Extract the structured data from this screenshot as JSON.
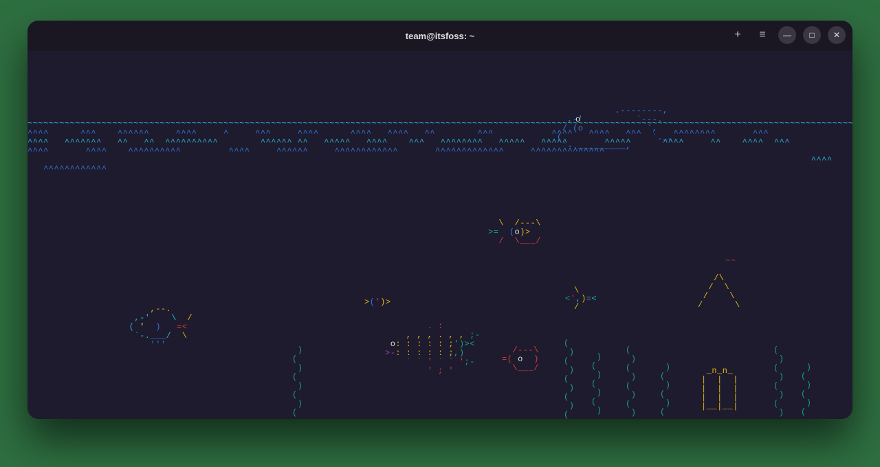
{
  "window": {
    "title": "team@itsfoss: ~"
  },
  "controls": {
    "new_tab": "+",
    "menu": "≡",
    "minimize": "—",
    "maximize": "□",
    "close": "✕"
  },
  "aquarium": {
    "water_surface": "~~~~~~~~~~~~~~~~~~~~~~~~~~~~~~~~~~~~~~~~~~~~~~~~~~~~~~~~~~~~~~~~~~~~~~~~~~~~~~~~~~~~~~~~~~~~~~~~~~~~~~~~~~~~~~~~~~~~~~~~~~~~~~~~~~~~~~~~~~~~~~~~~~~~~~~~~~~~~~~~~~~~~~~",
    "wave_rows": [
      "^^^^      ^^^    ^^^^^^     ^^^^     ^     ^^^     ^^^^      ^^^^   ^^^^   ^^        ^^^           ^^^^   ^^^^   ^^^      ^^^^^^^^       ^^^",
      "^^^^   ^^^^^^^   ^^   ^^  ^^^^^^^^^^        ^^^^^^ ^^   ^^^^^   ^^^^    ^^^   ^^^^^^^^   ^^^^^   ^^^^^       ^^^^^      ^^^^     ^^    ^^^^  ^^^",
      "^^^^       ^^^^    ^^^^^^^^^^         ^^^^     ^^^^^^     ^^^^^^^^^^^^       ^^^^^^^^^^^^^     ^^^^^^^^^^^^^^ ",
      "                                                                                                                                                    ^^^^",
      "   ^^^^^^^^^^^^"
    ],
    "whale": {
      "line1": "     .--------,    ",
      "line2": "  ,-'          `---.",
      "line3": " / (o            `,  ",
      "line4": "(                 `._,",
      "line5": " `-._________,      "
    },
    "fish_pufferhex": {
      "line1": "  \\  /---\\ ",
      "line2": " >=  ( o)>",
      "line3": "  /  \\___/ "
    },
    "fish_small_yellow": {
      "line1": ">(',>"
    },
    "fish_small_reverse": {
      "line1": "<',)= <"
    },
    "fish_big_blue": {
      "line1": "     ___   ",
      "line2": "  ,-'   \\  /",
      "line3": " ( '  )  =< ",
      "line4": "  `-.___/  \\",
      "line5": "     '''   "
    },
    "fish_detailed": {
      "line1": "        . : ",
      "line2": "    , , , . , , ;-",
      "line3": " o: : : : : ;')><",
      "line4": ">-: : : : : ;,)  ",
      "line5": "    ` ` ' ` ` ';-",
      "line6": "        ' ; '"
    },
    "fish_hex_red": {
      "line1": "  /---\\",
      "line2": "=( o  )",
      "line3": "  \\___/"
    },
    "seaweed_segment": "(",
    "seaweed_segment_r": ")",
    "ducky": {
      "line1": "  ~~ ",
      "line2": "  /\\ ",
      "line3": " /  \\",
      "line4": "/    \\"
    },
    "castle": {
      "line1": " _n_n_ ",
      "line2": "|  |  |",
      "line3": "|  |  |",
      "line4": "|__|__|"
    }
  }
}
